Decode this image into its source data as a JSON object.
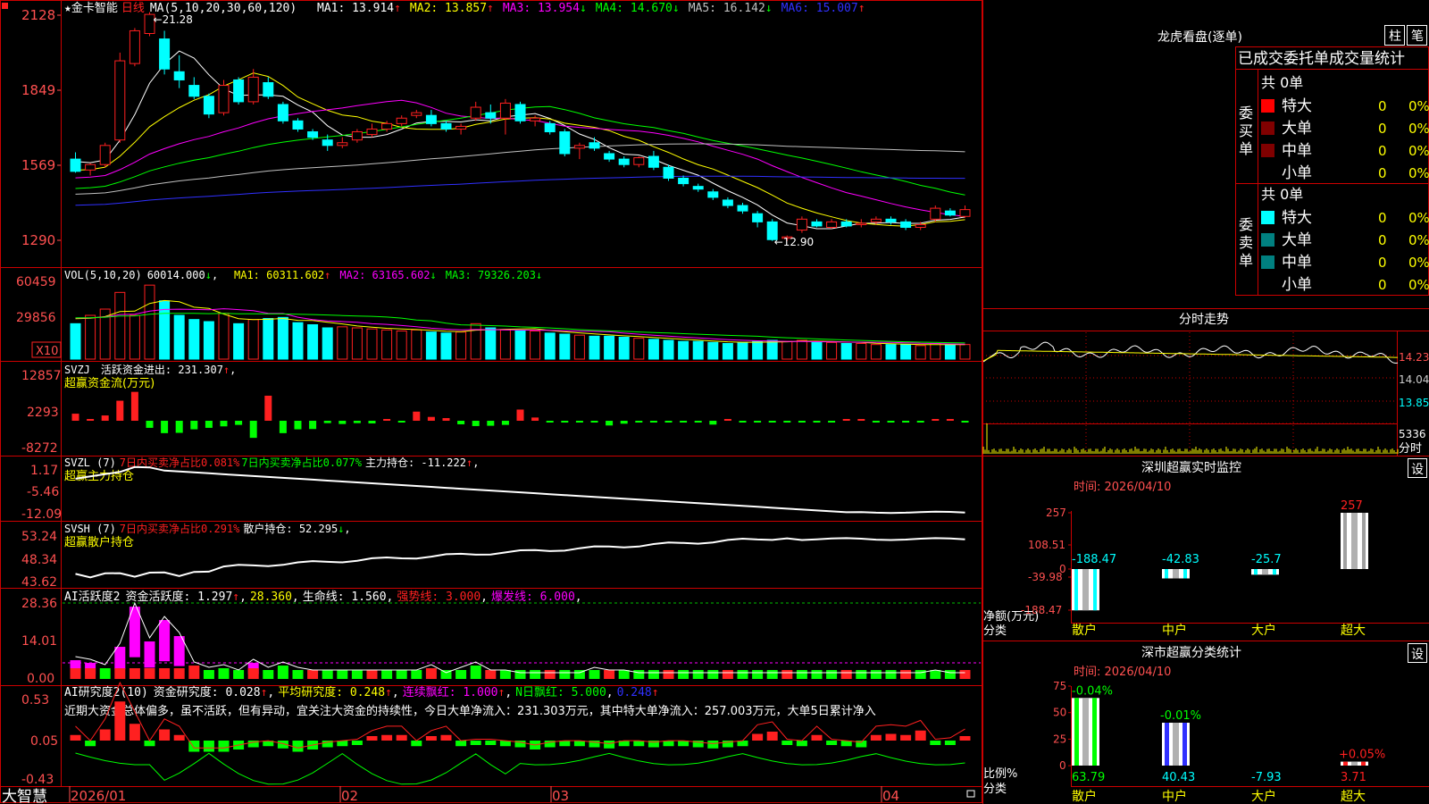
{
  "colors": {
    "up": "#ff2020",
    "down": "#00ffff",
    "green": "#00ff00",
    "yellow": "#ffff00",
    "magenta": "#ff00ff",
    "white": "#ffffff",
    "blue": "#3030ff",
    "grey": "#c0c0c0",
    "orange": "#ff8000",
    "frame": "#cc0000",
    "darkred": "#800000",
    "teal": "#008080"
  },
  "app": {
    "brand": "大智慧"
  },
  "main": {
    "title": "★金卡智能",
    "period_label": "日线",
    "ma_param": "MA(5,10,20,30,60,120)",
    "ma_values": [
      {
        "label": "MA1: 13.914",
        "arrow": "↑",
        "color": "#ffffff"
      },
      {
        "label": "MA2: 13.857",
        "arrow": "↑",
        "color": "#ffff00"
      },
      {
        "label": "MA3: 13.954",
        "arrow": "↓",
        "color": "#ff00ff"
      },
      {
        "label": "MA4: 14.670",
        "arrow": "↓",
        "color": "#00ff00"
      },
      {
        "label": "MA5: 16.142",
        "arrow": "↓",
        "color": "#c0c0c0"
      },
      {
        "label": "MA6: 15.007",
        "arrow": "↑",
        "color": "#3030ff"
      }
    ],
    "y_ticks": [
      "2128",
      "1849",
      "1569",
      "1290"
    ],
    "high_label": "21.28",
    "low_label": "12.90"
  },
  "volume": {
    "header": "VOL(5,10,20)",
    "value": "60014.000",
    "value_arrow": "↓",
    "ma": [
      {
        "label": "MA1: 60311.602",
        "arrow": "↑",
        "color": "#ffff00"
      },
      {
        "label": "MA2: 63165.602",
        "arrow": "↓",
        "color": "#ff00ff"
      },
      {
        "label": "MA3: 79326.203",
        "arrow": "↓",
        "color": "#00ff00"
      }
    ],
    "y_ticks": [
      "60459",
      "29856"
    ],
    "unit": "X10"
  },
  "svzj": {
    "header": "SVZJ",
    "label": "活跃资金进出: 231.307",
    "arrow": "↑",
    "subtitle": "超赢资金流(万元)",
    "y_ticks": [
      "12857",
      "2293",
      "-8272"
    ]
  },
  "svzl": {
    "header": "SVZL (7)",
    "label1": "7日内买卖净占比0.081%",
    "label2": "7日内买卖净占比0.077%",
    "label3": "主力持仓: -11.222",
    "arrow": "↑",
    "subtitle": "超赢主力持仓",
    "y_ticks": [
      "1.17",
      "-5.46",
      "-12.09"
    ]
  },
  "svsh": {
    "header": "SVSH (7)",
    "label1": "7日内买卖净占比0.291%",
    "label2": "散户持仓: 52.295",
    "arrow": "↓",
    "subtitle": "超赢散户持仓",
    "y_ticks": [
      "53.24",
      "48.34",
      "43.62"
    ]
  },
  "ai_active": {
    "header": "AI活跃度2",
    "label1": "资金活跃度: 1.297",
    "arrow1": "↑",
    "label2": "28.360",
    "label3": "生命线: 1.560",
    "label4": "强势线: 3.000",
    "label5": "爆发线: 6.000",
    "y_ticks": [
      "28.36",
      "14.01",
      "0.00"
    ]
  },
  "ai_research": {
    "header": "AI研究度2(10)",
    "label1": "资金研究度: 0.028",
    "arrow1": "↑",
    "label2": "平均研究度: 0.248",
    "arrow2": "↑",
    "label3": "连续飘红: 1.000",
    "arrow3": "↑",
    "label4": "N日飘红: 5.000",
    "label5": "0.248",
    "arrow5": "↑",
    "comment": "近期大资金总体偏多，虽不活跃，但有异动，宜关注大资金的持续性，今日大单净流入：231.303万元，其中特大单净流入：257.003万元，大单5日累计净入",
    "y_ticks": [
      "0.53",
      "0.05",
      "-0.43"
    ]
  },
  "x_axis": {
    "labels": [
      "2026/01",
      "02",
      "03",
      "04"
    ]
  },
  "longhu": {
    "title": "龙虎看盘(逐单)",
    "btn_bar": "柱",
    "btn_pen": "笔",
    "sub_title": "已成交委托单成交量统计",
    "buy": {
      "side_label": "委买单",
      "total": "共 0单",
      "rows": [
        {
          "label": "特大",
          "count": "0",
          "pct": "0%",
          "swatch": "#ff0000"
        },
        {
          "label": "大单",
          "count": "0",
          "pct": "0%",
          "swatch": "#800000"
        },
        {
          "label": "中单",
          "count": "0",
          "pct": "0%",
          "swatch": "#800000"
        },
        {
          "label": "小单",
          "count": "0",
          "pct": "0%",
          "swatch": ""
        }
      ]
    },
    "sell": {
      "side_label": "委卖单",
      "total": "共 0单",
      "rows": [
        {
          "label": "特大",
          "count": "0",
          "pct": "0%",
          "swatch": "#00ffff"
        },
        {
          "label": "大单",
          "count": "0",
          "pct": "0%",
          "swatch": "#008080"
        },
        {
          "label": "中单",
          "count": "0",
          "pct": "0%",
          "swatch": "#008080"
        },
        {
          "label": "小单",
          "count": "0",
          "pct": "0%",
          "swatch": ""
        }
      ]
    }
  },
  "intraday": {
    "title": "分时走势",
    "y_labels": [
      "14.23",
      "14.04",
      "13.85"
    ],
    "vol_label": "5336",
    "vol_unit": "分时"
  },
  "sz_monitor": {
    "title": "深圳超赢实时监控",
    "btn": "设",
    "time": "时间: 2026/04/10",
    "y_ticks": [
      "257",
      "108.51",
      "0",
      "-39.98",
      "-188.47"
    ],
    "y_caption": "净额(万元)",
    "x_caption": "分类",
    "chart_data": {
      "type": "bar",
      "categories": [
        "散户",
        "中户",
        "大户",
        "超大"
      ],
      "values": [
        -188.47,
        -42.83,
        -25.7,
        257
      ],
      "value_labels": [
        "-188.47",
        "-42.83",
        "-25.7",
        "257"
      ],
      "ylim": [
        -188.47,
        257
      ]
    }
  },
  "sh_stats": {
    "title": "深市超赢分类统计",
    "btn": "设",
    "time": "时间: 2026/04/10",
    "y_ticks": [
      "75",
      "50",
      "25",
      "0"
    ],
    "y_caption": "比例%",
    "x_caption": "分类",
    "chart_data": {
      "type": "bar",
      "categories": [
        "散户",
        "中户",
        "大户",
        "超大"
      ],
      "values": [
        63.79,
        40.43,
        -7.93,
        3.71
      ],
      "value_labels": [
        "63.79",
        "40.43",
        "-7.93",
        "3.71"
      ],
      "change_labels": [
        "-0.04%",
        "-0.01%",
        "",
        "+0.05%"
      ],
      "ylim": [
        0,
        75
      ]
    }
  },
  "kline": [
    {
      "o": 15.9,
      "h": 16.15,
      "l": 15.4,
      "c": 15.45
    },
    {
      "o": 15.5,
      "h": 15.75,
      "l": 15.3,
      "c": 15.7
    },
    {
      "o": 15.7,
      "h": 16.5,
      "l": 15.6,
      "c": 16.4
    },
    {
      "o": 16.6,
      "h": 19.8,
      "l": 16.5,
      "c": 19.5
    },
    {
      "o": 19.4,
      "h": 20.7,
      "l": 19.3,
      "c": 20.6
    },
    {
      "o": 20.5,
      "h": 21.28,
      "l": 20.4,
      "c": 21.2
    },
    {
      "o": 20.3,
      "h": 20.6,
      "l": 19.0,
      "c": 19.2
    },
    {
      "o": 19.1,
      "h": 19.7,
      "l": 18.5,
      "c": 18.8
    },
    {
      "o": 18.6,
      "h": 18.9,
      "l": 18.1,
      "c": 18.2
    },
    {
      "o": 18.2,
      "h": 18.3,
      "l": 17.4,
      "c": 17.55
    },
    {
      "o": 17.6,
      "h": 18.8,
      "l": 17.5,
      "c": 18.6
    },
    {
      "o": 18.8,
      "h": 18.9,
      "l": 17.9,
      "c": 18.0
    },
    {
      "o": 18.0,
      "h": 19.2,
      "l": 17.9,
      "c": 18.9
    },
    {
      "o": 18.7,
      "h": 18.9,
      "l": 18.1,
      "c": 18.2
    },
    {
      "o": 17.9,
      "h": 18.0,
      "l": 17.2,
      "c": 17.3
    },
    {
      "o": 17.3,
      "h": 17.4,
      "l": 16.9,
      "c": 17.0
    },
    {
      "o": 16.9,
      "h": 17.0,
      "l": 16.6,
      "c": 16.7
    },
    {
      "o": 16.6,
      "h": 16.8,
      "l": 16.2,
      "c": 16.4
    },
    {
      "o": 16.4,
      "h": 16.7,
      "l": 16.3,
      "c": 16.5
    },
    {
      "o": 16.6,
      "h": 17.0,
      "l": 16.5,
      "c": 16.9
    },
    {
      "o": 16.8,
      "h": 17.2,
      "l": 16.7,
      "c": 17.0
    },
    {
      "o": 17.0,
      "h": 17.3,
      "l": 16.9,
      "c": 17.2
    },
    {
      "o": 17.2,
      "h": 17.5,
      "l": 17.1,
      "c": 17.4
    },
    {
      "o": 17.5,
      "h": 17.7,
      "l": 17.4,
      "c": 17.6
    },
    {
      "o": 17.5,
      "h": 17.7,
      "l": 17.1,
      "c": 17.2
    },
    {
      "o": 17.2,
      "h": 17.3,
      "l": 16.9,
      "c": 17.0
    },
    {
      "o": 17.0,
      "h": 17.2,
      "l": 16.8,
      "c": 17.1
    },
    {
      "o": 17.4,
      "h": 18.0,
      "l": 17.3,
      "c": 17.8
    },
    {
      "o": 17.6,
      "h": 17.9,
      "l": 17.2,
      "c": 17.4
    },
    {
      "o": 17.4,
      "h": 18.1,
      "l": 16.8,
      "c": 17.95
    },
    {
      "o": 17.9,
      "h": 18.0,
      "l": 17.2,
      "c": 17.3
    },
    {
      "o": 17.3,
      "h": 17.5,
      "l": 17.1,
      "c": 17.4
    },
    {
      "o": 17.2,
      "h": 17.3,
      "l": 16.8,
      "c": 16.9
    },
    {
      "o": 16.9,
      "h": 17.0,
      "l": 16.0,
      "c": 16.1
    },
    {
      "o": 16.3,
      "h": 16.5,
      "l": 15.9,
      "c": 16.4
    },
    {
      "o": 16.5,
      "h": 16.7,
      "l": 16.2,
      "c": 16.3
    },
    {
      "o": 16.1,
      "h": 16.2,
      "l": 15.8,
      "c": 15.9
    },
    {
      "o": 15.9,
      "h": 16.0,
      "l": 15.6,
      "c": 15.7
    },
    {
      "o": 15.7,
      "h": 16.0,
      "l": 15.6,
      "c": 15.95
    },
    {
      "o": 16.0,
      "h": 16.2,
      "l": 15.5,
      "c": 15.6
    },
    {
      "o": 15.6,
      "h": 15.7,
      "l": 15.1,
      "c": 15.2
    },
    {
      "o": 15.2,
      "h": 15.3,
      "l": 14.9,
      "c": 15.0
    },
    {
      "o": 14.9,
      "h": 15.0,
      "l": 14.7,
      "c": 14.8
    },
    {
      "o": 14.7,
      "h": 14.8,
      "l": 14.4,
      "c": 14.5
    },
    {
      "o": 14.4,
      "h": 14.5,
      "l": 14.1,
      "c": 14.2
    },
    {
      "o": 14.2,
      "h": 14.3,
      "l": 13.9,
      "c": 14.0
    },
    {
      "o": 13.9,
      "h": 14.0,
      "l": 13.4,
      "c": 13.6
    },
    {
      "o": 13.6,
      "h": 13.7,
      "l": 12.9,
      "c": 12.95
    },
    {
      "o": 13.0,
      "h": 13.1,
      "l": 12.9,
      "c": 13.05
    },
    {
      "o": 13.3,
      "h": 13.8,
      "l": 13.2,
      "c": 13.7
    },
    {
      "o": 13.6,
      "h": 13.7,
      "l": 13.4,
      "c": 13.45
    },
    {
      "o": 13.4,
      "h": 13.7,
      "l": 13.35,
      "c": 13.6
    },
    {
      "o": 13.6,
      "h": 13.7,
      "l": 13.4,
      "c": 13.45
    },
    {
      "o": 13.5,
      "h": 13.7,
      "l": 13.4,
      "c": 13.55
    },
    {
      "o": 13.6,
      "h": 13.8,
      "l": 13.5,
      "c": 13.7
    },
    {
      "o": 13.7,
      "h": 13.8,
      "l": 13.5,
      "c": 13.6
    },
    {
      "o": 13.6,
      "h": 13.7,
      "l": 13.3,
      "c": 13.4
    },
    {
      "o": 13.4,
      "h": 13.6,
      "l": 13.3,
      "c": 13.5
    },
    {
      "o": 13.7,
      "h": 14.2,
      "l": 13.6,
      "c": 14.1
    },
    {
      "o": 14.0,
      "h": 14.1,
      "l": 13.8,
      "c": 13.85
    },
    {
      "o": 13.8,
      "h": 14.2,
      "l": 13.75,
      "c": 14.05
    }
  ],
  "volumes": [
    34000,
    42000,
    48000,
    64000,
    42000,
    71000,
    56000,
    42000,
    38000,
    36000,
    44000,
    34000,
    38000,
    39000,
    40000,
    35000,
    33000,
    30000,
    31000,
    30000,
    29000,
    28000,
    27000,
    28000,
    26000,
    25000,
    26000,
    34000,
    30000,
    28000,
    27000,
    27000,
    25000,
    24000,
    23000,
    22000,
    22000,
    21000,
    20000,
    19000,
    18000,
    17000,
    17000,
    16000,
    15000,
    16000,
    17000,
    18000,
    17000,
    18000,
    16000,
    16000,
    15000,
    15000,
    14000,
    14000,
    14000,
    13000,
    15000,
    14000,
    14000
  ],
  "svzj_vals": [
    2400,
    120,
    1800,
    6800,
    9800,
    -2400,
    -4200,
    -4100,
    -2900,
    -2400,
    -1900,
    -1400,
    -5800,
    8500,
    -4200,
    -2900,
    -2800,
    -800,
    -1100,
    -800,
    -900,
    600,
    -600,
    3100,
    1300,
    900,
    -1200,
    -1800,
    -1700,
    -1400,
    3800,
    1100,
    -500,
    -400,
    -200,
    -200,
    -1600,
    -1000,
    -500,
    -500,
    -100,
    -400,
    -400,
    -1300,
    200,
    -200,
    -200,
    -300,
    -200,
    -400,
    -400,
    -200,
    120,
    120,
    -200,
    -200,
    -200,
    -200,
    300,
    400,
    -100
  ],
  "ai_active_vals": [
    7,
    6,
    4,
    12,
    27,
    14,
    22,
    16,
    5,
    3,
    4,
    2,
    6,
    3,
    5,
    3,
    2,
    2,
    2,
    2,
    2,
    2,
    2,
    2,
    4,
    1,
    3,
    5,
    2,
    2,
    1,
    1,
    1,
    1,
    1,
    3,
    2,
    2,
    1,
    1,
    1,
    1,
    1,
    1,
    1,
    1,
    1,
    1,
    1,
    1,
    1,
    1,
    1,
    1,
    1,
    1,
    1,
    1,
    2,
    1,
    1
  ],
  "ai_research_vals": [
    0.05,
    -0.05,
    0.1,
    0.35,
    0.15,
    -0.05,
    0.1,
    0.05,
    -0.1,
    -0.1,
    -0.1,
    -0.08,
    -0.06,
    -0.05,
    -0.07,
    -0.1,
    -0.08,
    -0.06,
    -0.05,
    -0.04,
    0.02,
    0.05,
    0.05,
    -0.05,
    0.02,
    0.05,
    -0.05,
    -0.04,
    -0.04,
    -0.05,
    -0.06,
    -0.08,
    -0.06,
    -0.05,
    -0.05,
    -0.06,
    -0.07,
    -0.05,
    -0.05,
    -0.06,
    -0.05,
    -0.05,
    -0.06,
    -0.07,
    -0.06,
    -0.05,
    0.06,
    0.08,
    -0.04,
    -0.05,
    0.05,
    -0.04,
    -0.05,
    -0.06,
    0.05,
    0.06,
    0.05,
    0.09,
    -0.04,
    -0.03,
    0.03
  ]
}
